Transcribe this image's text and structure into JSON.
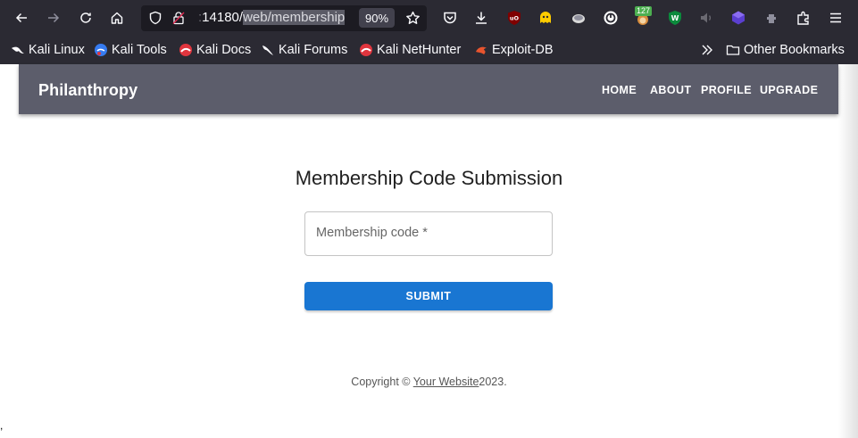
{
  "browser": {
    "url_prefix_faded": ":",
    "url_port": "14180/",
    "url_selected": "web/membership",
    "zoom": "90%"
  },
  "bookmarks": [
    {
      "label": "Kali Linux",
      "icon": "kali-dragon-icon"
    },
    {
      "label": "Kali Tools",
      "icon": "kali-tools-icon"
    },
    {
      "label": "Kali Docs",
      "icon": "kali-docs-icon"
    },
    {
      "label": "Kali Forums",
      "icon": "kali-forums-icon"
    },
    {
      "label": "Kali NetHunter",
      "icon": "kali-nethunter-icon"
    },
    {
      "label": "Exploit-DB",
      "icon": "exploit-db-icon"
    }
  ],
  "other_bookmarks": "Other Bookmarks",
  "extensions": {
    "badge_count": "127"
  },
  "app": {
    "brand": "Philanthropy",
    "nav": [
      "HOME",
      "ABOUT",
      "PROFILE",
      "UPGRADE"
    ]
  },
  "form": {
    "title": "Membership Code Submission",
    "field_label": "Membership code *",
    "field_value": "",
    "submit_label": "SUBMIT"
  },
  "footer": {
    "prefix": "Copyright © ",
    "link": "Your Website",
    "suffix": "2023."
  },
  "stray": ",",
  "colors": {
    "chrome": "#2b2a33",
    "urlbar": "#1c1b22",
    "appbar": "#5c5d6b",
    "primary": "#1976d2"
  }
}
